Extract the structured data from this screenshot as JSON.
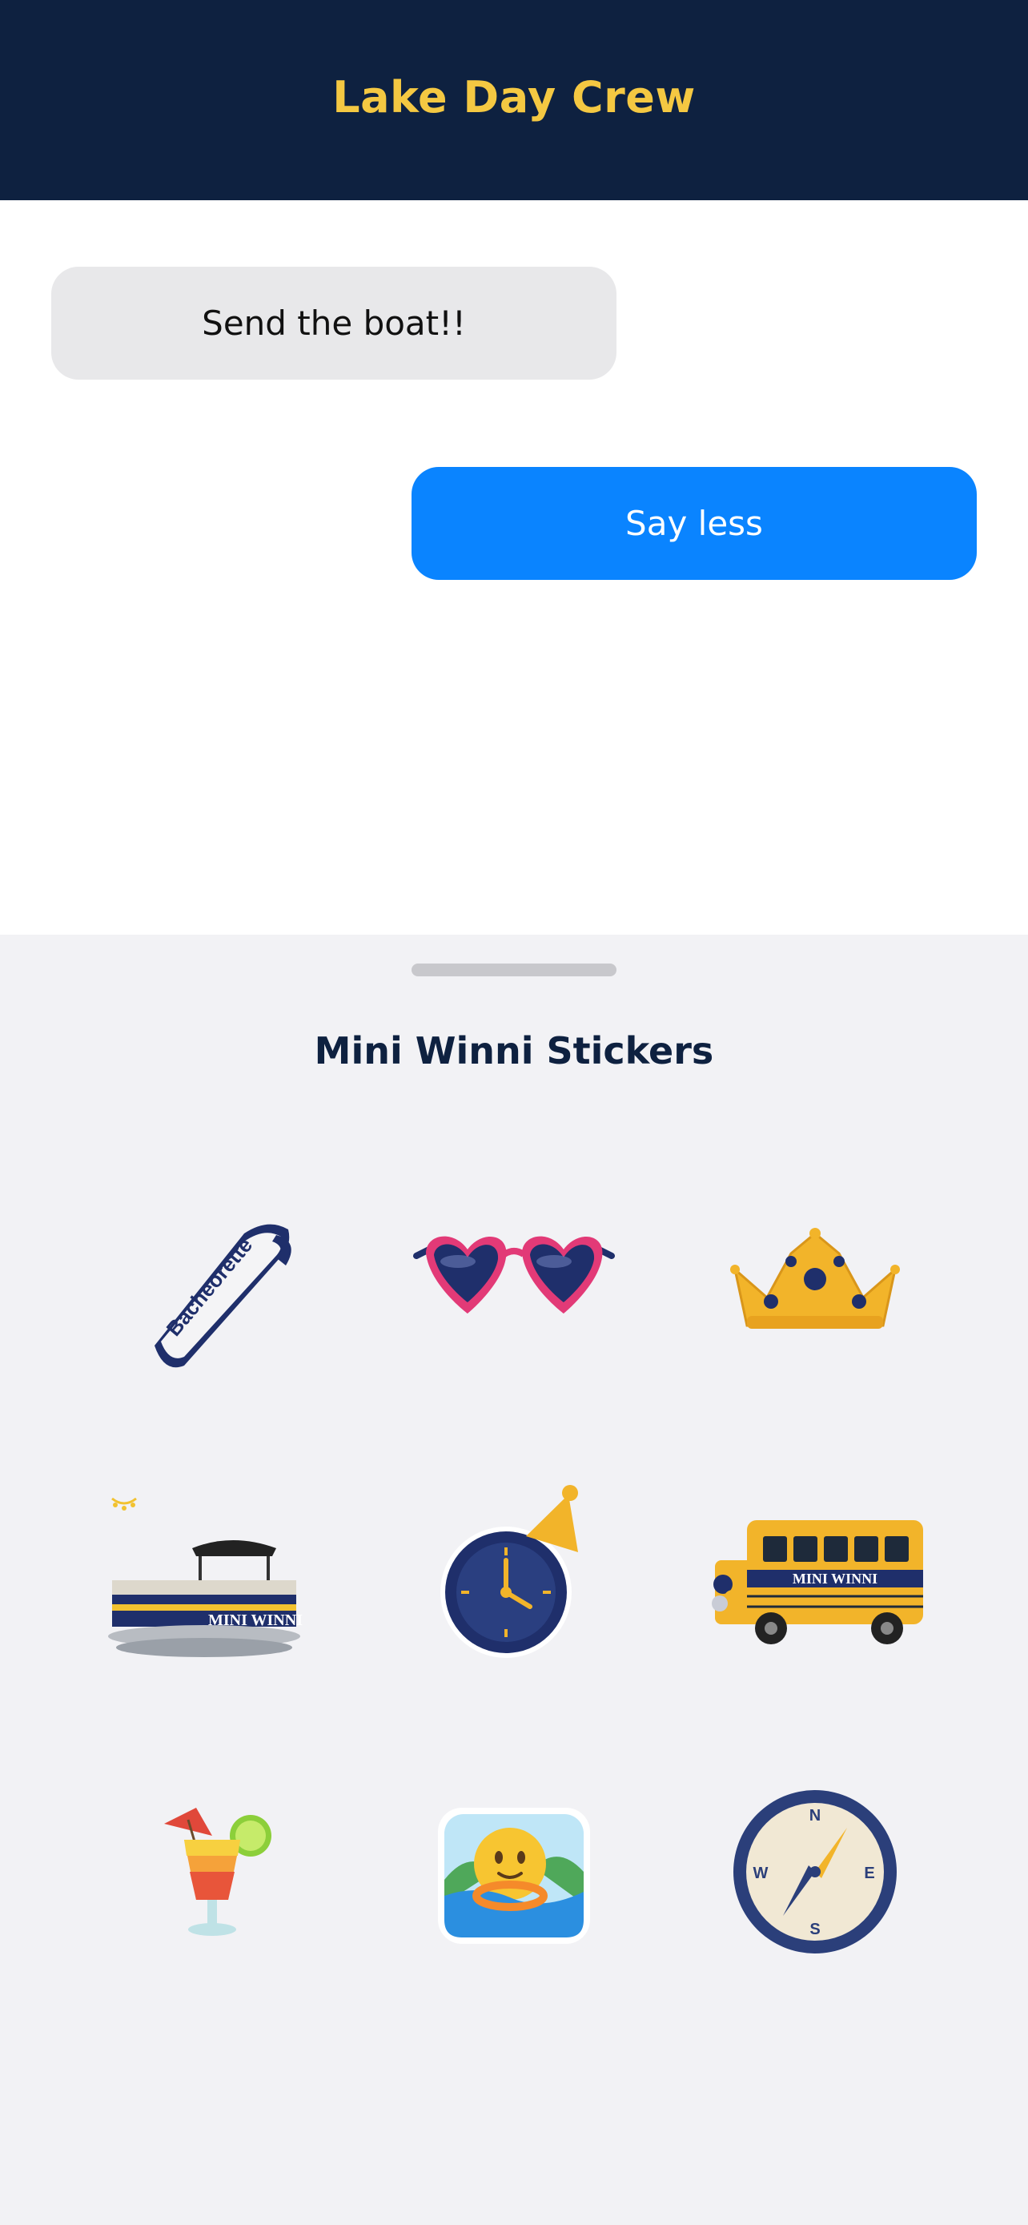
{
  "header": {
    "title": "Lake Day Crew"
  },
  "messages": [
    {
      "direction": "incoming",
      "text": "Send the boat!!"
    },
    {
      "direction": "outgoing",
      "text": "Say less"
    }
  ],
  "sticker_tray": {
    "title": "Mini Winni Stickers",
    "stickers": [
      {
        "name": "sash-sticker",
        "icon": "bachelorette-sash-icon",
        "text": "Bacheorette"
      },
      {
        "name": "sunglasses-sticker",
        "icon": "heart-sunglasses-icon"
      },
      {
        "name": "crown-sticker",
        "icon": "crown-icon"
      },
      {
        "name": "pontoon-boat-sticker",
        "icon": "pontoon-boat-icon",
        "text": "MINI WINNI"
      },
      {
        "name": "party-clock-sticker",
        "icon": "clock-party-hat-icon"
      },
      {
        "name": "party-bus-sticker",
        "icon": "school-bus-icon",
        "text": "MINI WINNI"
      },
      {
        "name": "cocktail-sticker",
        "icon": "tropical-drink-icon"
      },
      {
        "name": "swimming-emoji-sticker",
        "icon": "swimming-face-icon"
      },
      {
        "name": "compass-sticker",
        "icon": "compass-icon",
        "directions": [
          "N",
          "E",
          "S",
          "W"
        ]
      }
    ]
  },
  "colors": {
    "header_bg": "#0e2140",
    "header_title": "#f4c842",
    "incoming_bubble": "#e8e8ea",
    "outgoing_bubble": "#0a84ff",
    "tray_bg": "#f2f2f5",
    "navy": "#1f2f6b",
    "gold": "#f2b42a"
  }
}
